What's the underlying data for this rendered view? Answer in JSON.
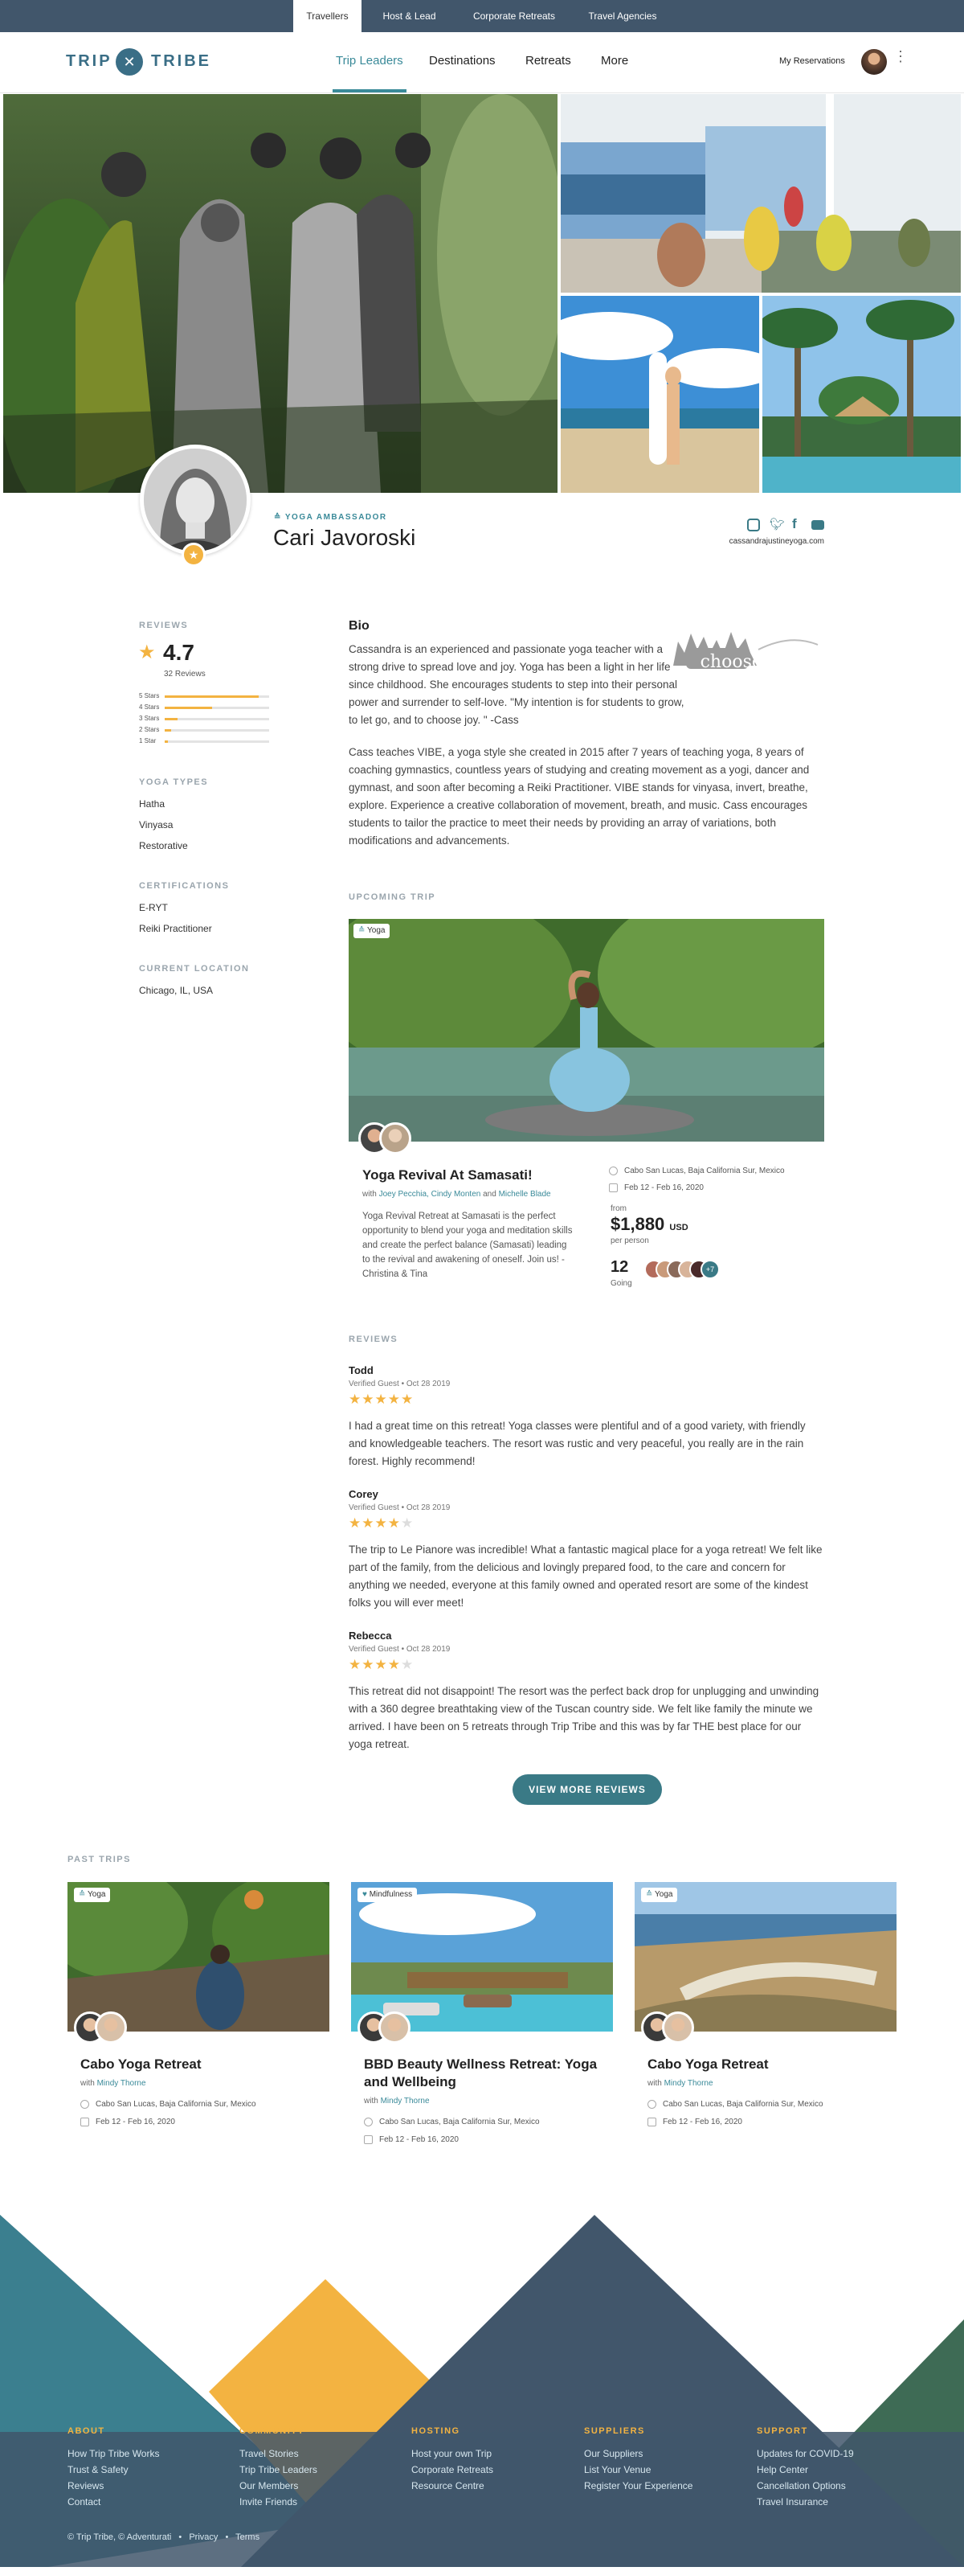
{
  "topbar": {
    "tabs": [
      "Travellers",
      "Host & Lead",
      "Corporate Retreats",
      "Travel Agencies"
    ]
  },
  "nav": {
    "logo_left": "TRIP",
    "logo_right": "TRIBE",
    "links": [
      "Trip Leaders",
      "Destinations",
      "Retreats",
      "More"
    ],
    "reservations": "My Reservations"
  },
  "profile": {
    "role": "YOGA AMBASSADOR",
    "name": "Cari Javoroski",
    "website": "cassandrajustineyoga.com",
    "social": [
      "instagram-icon",
      "twitter-icon",
      "facebook-icon",
      "youtube-icon"
    ]
  },
  "sidebar": {
    "reviews_heading": "REVIEWS",
    "rating": "4.7",
    "review_count": "32 Reviews",
    "breakdown": [
      {
        "label": "5 Stars",
        "fill": 0.9
      },
      {
        "label": "4 Stars",
        "fill": 0.45
      },
      {
        "label": "3 Stars",
        "fill": 0.12
      },
      {
        "label": "2 Stars",
        "fill": 0.06
      },
      {
        "label": "1 Star",
        "fill": 0.03
      }
    ],
    "yoga_types_heading": "YOGA TYPES",
    "yoga_types": [
      "Hatha",
      "Vinyasa",
      "Restorative"
    ],
    "certifications_heading": "CERTIFICATIONS",
    "certifications": [
      "E-RYT",
      "Reiki Practitioner"
    ],
    "location_heading": "CURRENT LOCATION",
    "location": "Chicago, IL, USA"
  },
  "bio": {
    "heading": "Bio",
    "logo_text": "choose joy",
    "paragraph1": "Cassandra is an experienced and passionate yoga teacher with a strong drive to spread love and joy. Yoga has been a light in her life since childhood. She encourages students to step into their personal power and surrender to self-love. \"My intention is for students to grow, to let go, and to choose joy. \" -Cass",
    "paragraph2": "Cass teaches VIBE, a yoga style she created in 2015 after 7 years of teaching yoga, 8 years of coaching gymnastics, countless years of studying and creating movement as a yogi, dancer and gymnast, and soon after becoming a Reiki Practitioner. VIBE stands for vinyasa, invert, breathe, explore. Experience a creative collaboration of movement, breath, and music. Cass encourages students to tailor the practice to meet their needs by providing an array of variations, both modifications and advancements."
  },
  "upcoming": {
    "heading": "UPCOMING TRIP",
    "tag": "Yoga",
    "title": "Yoga Revival At Samasati!",
    "with_prefix": "with",
    "leaders": "Joey Pecchia, Cindy Monten",
    "and": "and",
    "leader_last": "Michelle Blade",
    "description": "Yoga Revival Retreat at Samasati is the perfect opportunity to blend your yoga and meditation skills and create the perfect balance (Samasati) leading to the revival and awakening of oneself. Join us! - Christina & Tina",
    "location": "Cabo San Lucas, Baja California Sur, Mexico",
    "dates": "Feb 12 - Feb 16, 2020",
    "from": "from",
    "price": "$1,880",
    "currency": "USD",
    "per": "per person",
    "going_count": "12",
    "going_label": "Going",
    "more_count": "+7"
  },
  "reviews": {
    "heading": "REVIEWS",
    "items": [
      {
        "name": "Todd",
        "meta": "Verified Guest  •  Oct 28 2019",
        "rating": 5,
        "text": "I had a great time on this retreat! Yoga classes were plentiful and of a good variety, with friendly and knowledgeable teachers. The resort was rustic and very peaceful, you really are in the rain forest. Highly recommend!"
      },
      {
        "name": "Corey",
        "meta": "Verified Guest  •  Oct 28 2019",
        "rating": 4,
        "text": "The trip to Le Pianore was incredible! What a fantastic magical place for a yoga retreat! We felt like part of the family, from the delicious and lovingly prepared food, to the care and concern for anything we needed, everyone at this family owned and operated resort are some of the kindest folks you will ever meet!"
      },
      {
        "name": "Rebecca",
        "meta": "Verified Guest  •  Oct 28 2019",
        "rating": 4,
        "text": "This retreat did not disappoint! The resort was the perfect back drop for unplugging and unwinding with a 360 degree breathtaking view of the Tuscan country side. We felt like family the minute we arrived. I have been on 5 retreats through Trip Tribe and this was by far THE best place for our yoga retreat."
      }
    ],
    "view_more": "VIEW MORE REVIEWS"
  },
  "past": {
    "heading": "PAST TRIPS",
    "trips": [
      {
        "tag": "Yoga",
        "title": "Cabo Yoga Retreat",
        "with": "with",
        "leader": "Mindy Thorne",
        "location": "Cabo San Lucas, Baja California Sur, Mexico",
        "dates": "Feb 12 - Feb 16, 2020"
      },
      {
        "tag": "Mindfulness",
        "title": "BBD Beauty Wellness Retreat: Yoga and Wellbeing",
        "with": "with",
        "leader": "Mindy Thorne",
        "location": "Cabo San Lucas, Baja California Sur, Mexico",
        "dates": "Feb 12 - Feb 16, 2020"
      },
      {
        "tag": "Yoga",
        "title": "Cabo Yoga Retreat",
        "with": "with",
        "leader": "Mindy Thorne",
        "location": "Cabo San Lucas, Baja California Sur, Mexico",
        "dates": "Feb 12 - Feb 16, 2020"
      }
    ]
  },
  "footer": {
    "columns": [
      {
        "heading": "ABOUT",
        "links": [
          "How Trip Tribe Works",
          "Trust & Safety",
          "Reviews",
          "Contact"
        ]
      },
      {
        "heading": "COMMUNITY",
        "links": [
          "Travel Stories",
          "Trip Tribe Leaders",
          "Our Members",
          "Invite Friends"
        ]
      },
      {
        "heading": "HOSTING",
        "links": [
          "Host your own Trip",
          "Corporate Retreats",
          "Resource Centre"
        ]
      },
      {
        "heading": "SUPPLIERS",
        "links": [
          "Our Suppliers",
          "List Your Venue",
          "Register Your Experience"
        ]
      },
      {
        "heading": "SUPPORT",
        "links": [
          "Updates for COVID-19",
          "Help Center",
          "Cancellation Options",
          "Travel Insurance"
        ]
      }
    ],
    "copyright": "© Trip Tribe, © Adventurati",
    "privacy": "Privacy",
    "terms": "Terms"
  },
  "colors": {
    "accent": "#3a8a99",
    "star": "#f3b341",
    "dark_blue": "#41566b"
  }
}
